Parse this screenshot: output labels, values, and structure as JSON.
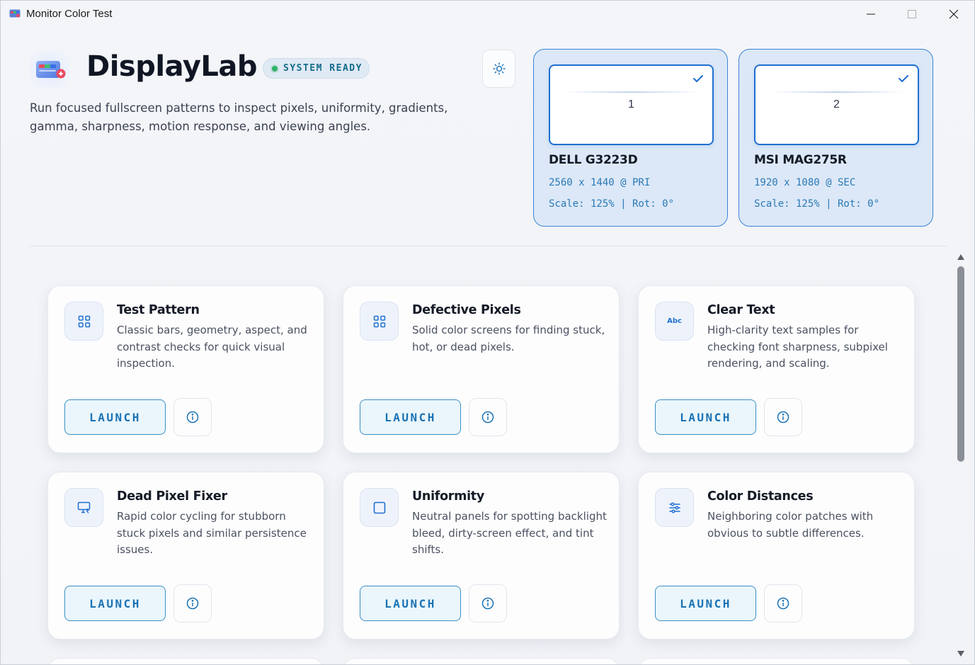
{
  "window": {
    "title": "Monitor Color Test"
  },
  "header": {
    "brand": "DisplayLab",
    "status": "SYSTEM READY",
    "subtitle": "Run focused fullscreen patterns to inspect pixels, uniformity, gradients, gamma, sharpness, motion response, and viewing angles."
  },
  "monitors": [
    {
      "number": "1",
      "name": "DELL G3223D",
      "resolution": "2560 x 1440 @ PRI",
      "scale": "Scale: 125% | Rot: 0°",
      "selected": true
    },
    {
      "number": "2",
      "name": "MSI MAG275R",
      "resolution": "1920 x 1080 @ SEC",
      "scale": "Scale: 125% | Rot: 0°",
      "selected": true
    }
  ],
  "tests": [
    {
      "title": "Test Pattern",
      "description": "Classic bars, geometry, aspect, and contrast checks for quick visual inspection.",
      "icon": "grid-icon",
      "launch_label": "LAUNCH"
    },
    {
      "title": "Defective Pixels",
      "description": "Solid color screens for finding stuck, hot, or dead pixels.",
      "icon": "grid-icon",
      "launch_label": "LAUNCH"
    },
    {
      "title": "Clear Text",
      "description": "High-clarity text samples for checking font sharpness, subpixel rendering, and scaling.",
      "icon": "text-abc-icon",
      "icon_text": "Abc",
      "launch_label": "LAUNCH"
    },
    {
      "title": "Dead Pixel Fixer",
      "description": "Rapid color cycling for stubborn stuck pixels and similar persistence issues.",
      "icon": "monitor-repair-icon",
      "launch_label": "LAUNCH"
    },
    {
      "title": "Uniformity",
      "description": "Neutral panels for spotting backlight bleed, dirty-screen effect, and tint shifts.",
      "icon": "square-icon",
      "launch_label": "LAUNCH"
    },
    {
      "title": "Color Distances",
      "description": "Neighboring color patches with obvious to subtle differences.",
      "icon": "sliders-icon",
      "launch_label": "LAUNCH"
    }
  ],
  "colors": {
    "accent": "#1f6fd0",
    "launch_text": "#1b73b5",
    "status_dot": "#2fb26a"
  }
}
